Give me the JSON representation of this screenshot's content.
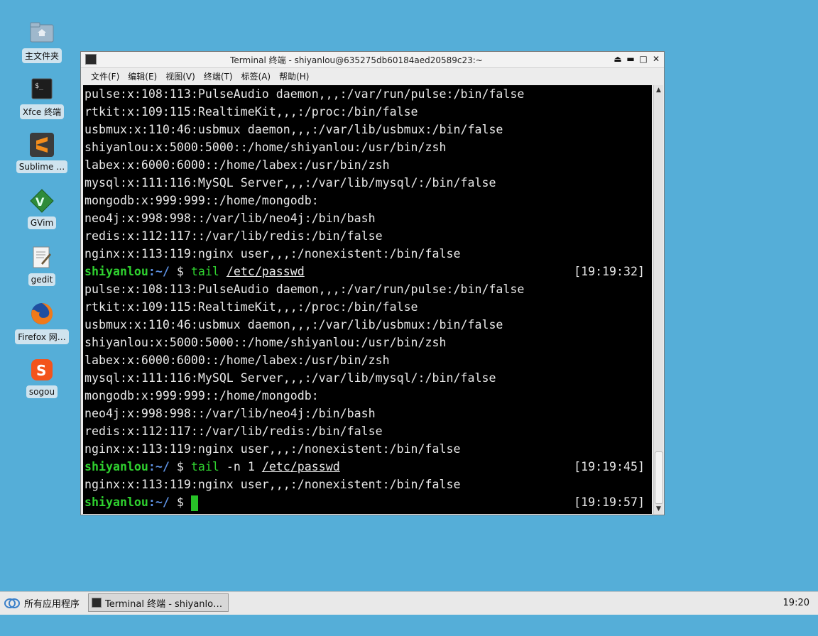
{
  "desktop": {
    "icons": [
      {
        "label": "主文件夹",
        "icon": "folder-home-icon"
      },
      {
        "label": "Xfce 终端",
        "icon": "terminal-icon"
      },
      {
        "label": "Sublime …",
        "icon": "sublime-icon"
      },
      {
        "label": "GVim",
        "icon": "gvim-icon"
      },
      {
        "label": "gedit",
        "icon": "gedit-icon"
      },
      {
        "label": "Firefox 网…",
        "icon": "firefox-icon"
      },
      {
        "label": "sogou",
        "icon": "sogou-icon"
      }
    ]
  },
  "window": {
    "title": "Terminal 终端 - shiyanlou@635275db60184aed20589c23:~",
    "menu": [
      "文件(F)",
      "编辑(E)",
      "视图(V)",
      "终端(T)",
      "标签(A)",
      "帮助(H)"
    ]
  },
  "terminal": {
    "lines": [
      "pulse:x:108:113:PulseAudio daemon,,,:/var/run/pulse:/bin/false",
      "rtkit:x:109:115:RealtimeKit,,,:/proc:/bin/false",
      "usbmux:x:110:46:usbmux daemon,,,:/var/lib/usbmux:/bin/false",
      "shiyanlou:x:5000:5000::/home/shiyanlou:/usr/bin/zsh",
      "labex:x:6000:6000::/home/labex:/usr/bin/zsh",
      "mysql:x:111:116:MySQL Server,,,:/var/lib/mysql/:/bin/false",
      "mongodb:x:999:999::/home/mongodb:",
      "neo4j:x:998:998::/var/lib/neo4j:/bin/bash",
      "redis:x:112:117::/var/lib/redis:/bin/false",
      "nginx:x:113:119:nginx user,,,:/nonexistent:/bin/false",
      {
        "prompt_user": "shiyanlou",
        "prompt_dir": "~/",
        "cmd": "tail",
        "args": "",
        "path": "/etc/passwd",
        "time": "[19:19:32]"
      },
      "pulse:x:108:113:PulseAudio daemon,,,:/var/run/pulse:/bin/false",
      "rtkit:x:109:115:RealtimeKit,,,:/proc:/bin/false",
      "usbmux:x:110:46:usbmux daemon,,,:/var/lib/usbmux:/bin/false",
      "shiyanlou:x:5000:5000::/home/shiyanlou:/usr/bin/zsh",
      "labex:x:6000:6000::/home/labex:/usr/bin/zsh",
      "mysql:x:111:116:MySQL Server,,,:/var/lib/mysql/:/bin/false",
      "mongodb:x:999:999::/home/mongodb:",
      "neo4j:x:998:998::/var/lib/neo4j:/bin/bash",
      "redis:x:112:117::/var/lib/redis:/bin/false",
      "nginx:x:113:119:nginx user,,,:/nonexistent:/bin/false",
      {
        "prompt_user": "shiyanlou",
        "prompt_dir": "~/",
        "cmd": "tail",
        "args": "-n 1",
        "path": "/etc/passwd",
        "time": "[19:19:45]"
      },
      "nginx:x:113:119:nginx user,,,:/nonexistent:/bin/false",
      {
        "prompt_user": "shiyanlou",
        "prompt_dir": "~/",
        "cmd": "",
        "args": "",
        "path": "",
        "time": "[19:19:57]",
        "cursor": true
      }
    ]
  },
  "taskbar": {
    "apps_menu_label": "所有应用程序",
    "task_label": "Terminal 终端 - shiyanlou@…",
    "clock": "19:20"
  },
  "colors": {
    "desktop_bg": "#55aed8",
    "prompt_green": "#2fd12f",
    "prompt_dir_blue": "#5c8fe0",
    "terminal_bg": "#000000"
  }
}
